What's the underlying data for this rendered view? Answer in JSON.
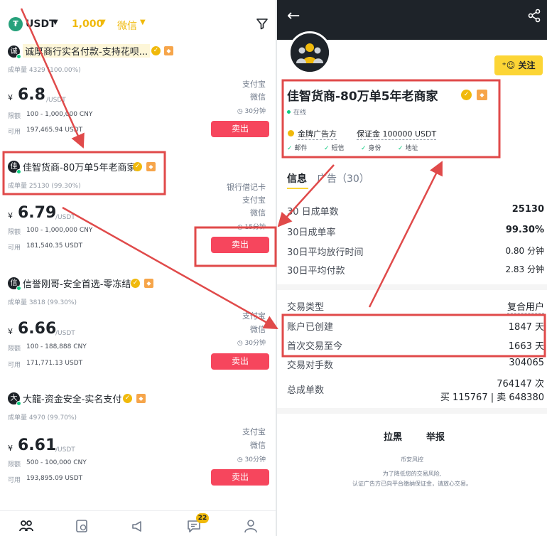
{
  "left": {
    "topbar": {
      "coin": "USDT",
      "amount": "1,000",
      "payment": "微信"
    },
    "cards": [
      {
        "avatar": "诚",
        "merchant": "诚厚商行实名付款-支持花呗...",
        "stat": "成单量 4329 (100.00%)",
        "price": "6.8",
        "unit": "/USDT",
        "limit_label": "限额",
        "limit": "100 - 1,000,000 CNY",
        "avail_label": "可用",
        "avail": "197,465.94 USDT",
        "methods": [
          "支付宝",
          "微信"
        ],
        "time": "30分钟",
        "btn": "卖出"
      },
      {
        "avatar": "佳",
        "merchant": "佳智货商-80万单5年老商家",
        "stat": "成单量 25130 (99.30%)",
        "price": "6.79",
        "unit": "/USDT",
        "limit_label": "限额",
        "limit": "100 - 1,000,000 CNY",
        "avail_label": "可用",
        "avail": "181,540.35 USDT",
        "methods": [
          "银行借记卡",
          "支付宝",
          "微信"
        ],
        "time": "15分钟",
        "btn": "卖出"
      },
      {
        "avatar": "信",
        "merchant": "信誉刚哥-安全首选-零冻结",
        "stat": "成单量 3818 (99.30%)",
        "price": "6.66",
        "unit": "/USDT",
        "limit_label": "限额",
        "limit": "100 - 188,888 CNY",
        "avail_label": "可用",
        "avail": "171,771.13 USDT",
        "methods": [
          "支付宝",
          "微信"
        ],
        "time": "30分钟",
        "btn": "卖出"
      },
      {
        "avatar": "大",
        "merchant": "大龍-资金安全-实名支付",
        "stat": "成单量 4970 (99.70%)",
        "price": "6.61",
        "unit": "/USDT",
        "limit_label": "限额",
        "limit": "500 - 100,000 CNY",
        "avail_label": "可用",
        "avail": "193,895.09 USDT",
        "methods": [
          "支付宝",
          "微信"
        ],
        "time": "30分钟",
        "btn": "卖出"
      }
    ],
    "price_symbol": "¥",
    "notif_count": "22"
  },
  "right": {
    "follow": "关注",
    "name": "佳智货商-80万单5年老商家",
    "online": "在线",
    "gold_adv": "金牌广告方",
    "deposit": "保证金 100000 USDT",
    "verify": [
      "邮件",
      "短信",
      "身份",
      "地址"
    ],
    "tabs": [
      "信息",
      "广告（30）"
    ],
    "stats1": [
      {
        "k": "30 日成单数",
        "v": "25130"
      },
      {
        "k": "30日成单率",
        "v": "99.30%"
      },
      {
        "k": "30日平均放行时间",
        "v": "0.80 分钟"
      },
      {
        "k": "30日平均付款",
        "v": "2.83 分钟"
      }
    ],
    "stats2": [
      {
        "k": "交易类型",
        "v": "复合用户"
      },
      {
        "k": "账户已创建",
        "v": "1847 天"
      },
      {
        "k": "首次交易至今",
        "v": "1663 天"
      },
      {
        "k": "交易对手数",
        "v": "304065"
      },
      {
        "k": "总成单数",
        "v": "764147 次"
      }
    ],
    "total_split": "买 115767 | 卖 648380",
    "block": "拉黑",
    "report": "举报",
    "risk_title": "币安风控",
    "risk_line1": "为了降低您的交易风险,",
    "risk_line2": "认证广告方已向平台缴纳保证金，请放心交易。"
  },
  "colors": {
    "sell": "#f6465d",
    "gold": "#f0b90b",
    "highlight": "#e04a4a"
  }
}
